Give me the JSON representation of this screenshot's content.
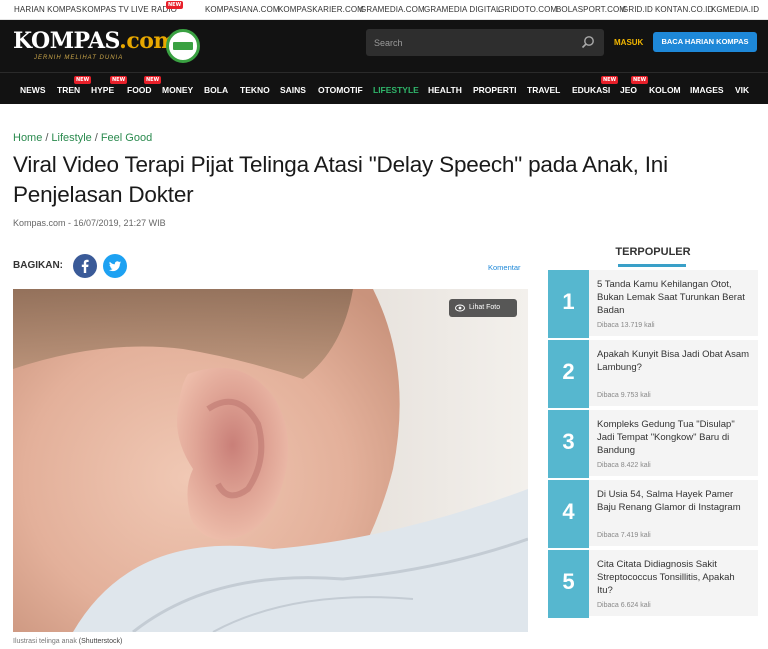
{
  "network": {
    "links": [
      "HARIAN KOMPAS",
      "KOMPAS TV",
      "LIVE RADIO",
      "KOMPASIANA.COM",
      "KOMPASKARIER.COM",
      "GRAMEDIA.COM",
      "GRAMEDIA DIGITAL",
      "GRIDOTO.COM",
      "BOLASPORT.COM",
      "GRID.ID",
      "KONTAN.CO.ID",
      "KGMEDIA.ID"
    ],
    "new_label": "NEW"
  },
  "header": {
    "logo_text": "KOMPAS",
    "logo_suffix": ".com",
    "tagline": "JERNIH MELIHAT DUNIA",
    "search_placeholder": "Search",
    "login_label": "MASUK",
    "subscribe_label": "BACA HARIAN KOMPAS"
  },
  "nav": {
    "items": [
      "NEWS",
      "TREN",
      "HYPE",
      "FOOD",
      "MONEY",
      "BOLA",
      "TEKNO",
      "SAINS",
      "OTOMOTIF",
      "LIFESTYLE",
      "HEALTH",
      "PROPERTI",
      "TRAVEL",
      "EDUKASI",
      "JEO",
      "KOLOM",
      "IMAGES",
      "VIK"
    ],
    "active": "LIFESTYLE"
  },
  "article": {
    "breadcrumb": [
      "Home",
      "Lifestyle",
      "Feel Good"
    ],
    "breadcrumb_sep": "/",
    "title": "Viral Video Terapi Pijat Telinga Atasi \"Delay Speech\" pada Anak, Ini Penjelasan Dokter",
    "byline": "Kompas.com - 16/07/2019, 21:27 WIB",
    "share_label": "BAGIKAN:",
    "comment_label": "Komentar",
    "view_photo_label": "Lihat Foto",
    "caption": "Ilustrasi telinga anak",
    "caption_credit": "(Shutterstock)"
  },
  "sidebar": {
    "title": "TERPOPULER",
    "items": [
      {
        "rank": "1",
        "title": "5 Tanda Kamu Kehilangan Otot, Bukan Lemak Saat Turunkan Berat Badan",
        "views": "Dibaca 13.719 kali"
      },
      {
        "rank": "2",
        "title": "Apakah Kunyit Bisa Jadi Obat Asam Lambung?",
        "views": "Dibaca 9.753 kali"
      },
      {
        "rank": "3",
        "title": "Kompleks Gedung Tua \"Disulap\" Jadi Tempat \"Kongkow\" Baru di Bandung",
        "views": "Dibaca 8.422 kali"
      },
      {
        "rank": "4",
        "title": "Di Usia 54, Salma Hayek Pamer Baju Renang Glamor di Instagram",
        "views": "Dibaca 7.419 kali"
      },
      {
        "rank": "5",
        "title": "Cita Citata Didiagnosis Sakit Streptococcus Tonsillitis, Apakah Itu?",
        "views": "Dibaca 6.624 kali"
      }
    ]
  },
  "colors": {
    "header_bg": "#121212",
    "accent_green": "#2a8a4e",
    "nav_active": "#2fb56a",
    "login_yellow": "#f2b600",
    "subscribe_blue": "#1e88d8",
    "rank_blue": "#56b7cf",
    "new_red": "#e8202a"
  }
}
